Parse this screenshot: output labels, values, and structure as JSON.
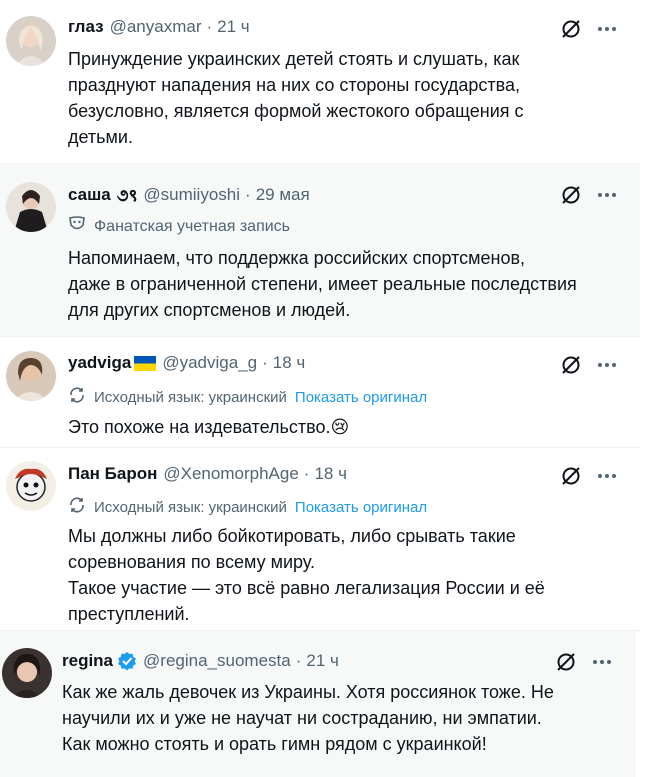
{
  "posts": [
    {
      "name": "глаз",
      "handle": "@anyaxmar",
      "dot": "·",
      "time": "21 ч",
      "text": "Принуждение украинских детей стоять и слушать, как\nпразднуют нападения на них со стороны государства,\nбезусловно, является формой жестокого обращения с\nдетьми.",
      "avatar_icon": "user-avatar",
      "bg": "#ffffff"
    },
    {
      "name": "саша",
      "name_extra": "૭९",
      "handle": "@sumiiyoshi",
      "dot": "·",
      "time": "29 мая",
      "fan_label": "Фанатская учетная запись",
      "text": "Напоминаем, что поддержка российских спортсменов,\nдаже в ограниченной степени, имеет реальные последствия\nдля других спортсменов и людей.",
      "avatar_icon": "user-avatar",
      "bg": "#f7f9f9"
    },
    {
      "name": "yadviga",
      "handle": "@yadviga_g",
      "dot": "·",
      "time": "18 ч",
      "source_lang": "Исходный язык: украинский",
      "show_original": "Показать оригинал",
      "text": "Это похоже на издевательство.😢",
      "avatar_icon": "user-avatar",
      "bg": "#ffffff"
    },
    {
      "name": "Пан Барон",
      "handle": "@XenomorphAge",
      "dot": "·",
      "time": "18 ч",
      "source_lang": "Исходный язык: украинский",
      "show_original": "Показать оригинал",
      "text": "Мы должны либо бойкотировать, либо срывать такие\nсоревнования по всему миру.\nТакое участие — это всё равно легализация России и её\nпреступлений.",
      "avatar_icon": "user-avatar",
      "bg": "#ffffff"
    },
    {
      "name": "regina",
      "handle": "@regina_suomesta",
      "dot": "·",
      "time": "21 ч",
      "text": "Как же жаль девочек из Украины. Хотя россиянок тоже. Не\nнаучили их и уже не научат ни состраданию, ни эмпатии.\nКак можно стоять и орать гимн рядом с украинкой!",
      "avatar_icon": "user-avatar",
      "verified_icon": "verified-badge-icon",
      "bg": "#f7f9f9"
    }
  ],
  "icons": {
    "grok": "grok-icon",
    "more": "more-icon",
    "translate": "translate-icon",
    "mask": "mask-icon"
  },
  "colors": {
    "link": "#1d9bf0",
    "muted": "#536471",
    "verified": "#1d9bf0",
    "hover_bg": "#f7f9f9"
  }
}
